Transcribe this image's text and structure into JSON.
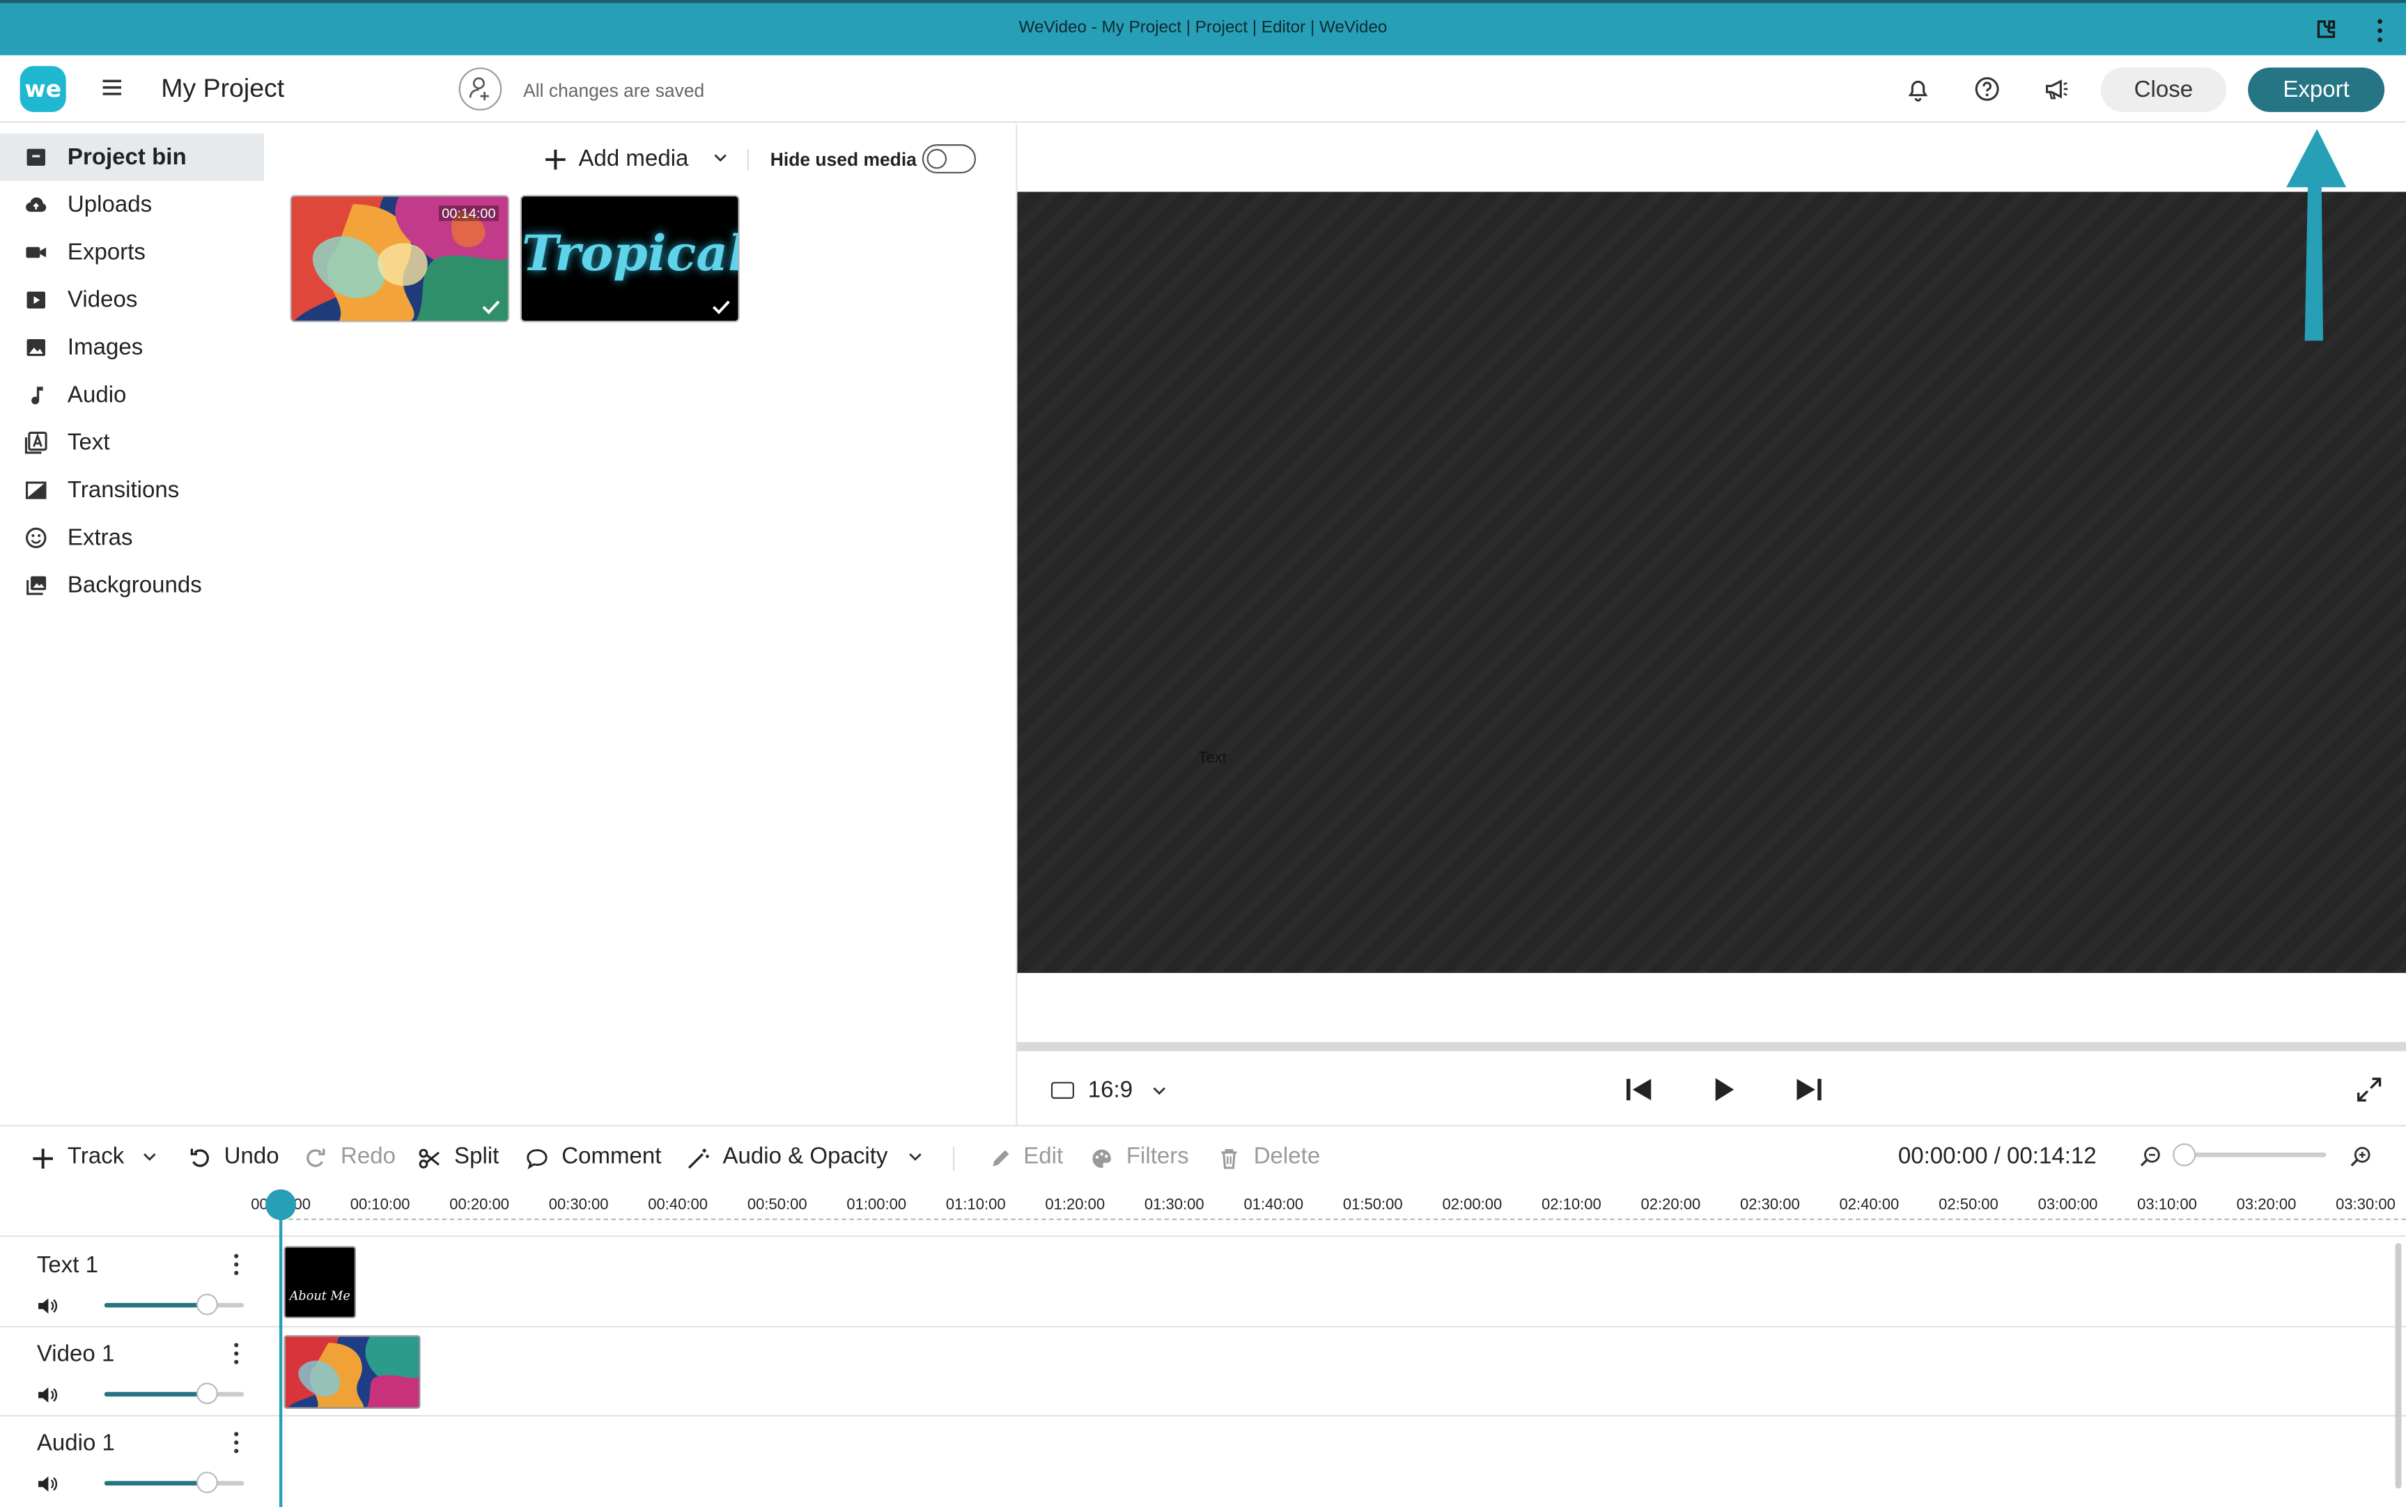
{
  "window": {
    "title": "WeVideo - My Project | Project | Editor | WeVideo"
  },
  "header": {
    "logo_text": "we",
    "project_title": "My Project",
    "save_status": "All changes are saved",
    "close_label": "Close",
    "export_label": "Export"
  },
  "sidebar": {
    "items": [
      {
        "label": "Project bin",
        "icon": "archive-icon",
        "active": true
      },
      {
        "label": "Uploads",
        "icon": "cloud-upload-icon"
      },
      {
        "label": "Exports",
        "icon": "video-camera-icon"
      },
      {
        "label": "Videos",
        "icon": "play-square-icon"
      },
      {
        "label": "Images",
        "icon": "image-icon"
      },
      {
        "label": "Audio",
        "icon": "music-note-icon"
      },
      {
        "label": "Text",
        "icon": "text-icon"
      },
      {
        "label": "Transitions",
        "icon": "transition-icon"
      },
      {
        "label": "Extras",
        "icon": "smiley-icon"
      },
      {
        "label": "Backgrounds",
        "icon": "backgrounds-icon"
      }
    ]
  },
  "media": {
    "add_media_label": "Add media",
    "hide_used_label": "Hide used media",
    "hide_used_on": false,
    "items": [
      {
        "type": "video",
        "duration": "00:14:00",
        "used": true
      },
      {
        "type": "text",
        "title_text": "Tropical",
        "used": true
      }
    ]
  },
  "preview": {
    "overlay_text": "Text",
    "aspect_ratio": "16:9"
  },
  "toolbar": {
    "track_label": "Track",
    "undo_label": "Undo",
    "redo_label": "Redo",
    "split_label": "Split",
    "comment_label": "Comment",
    "audio_opacity_label": "Audio & Opacity",
    "edit_label": "Edit",
    "filters_label": "Filters",
    "delete_label": "Delete",
    "timecode": "00:00:00 / 00:14:12"
  },
  "ruler": {
    "ticks": [
      "00:00:00",
      "00:10:00",
      "00:20:00",
      "00:30:00",
      "00:40:00",
      "00:50:00",
      "01:00:00",
      "01:10:00",
      "01:20:00",
      "01:30:00",
      "01:40:00",
      "01:50:00",
      "02:00:00",
      "02:10:00",
      "02:20:00",
      "02:30:00",
      "02:40:00",
      "02:50:00",
      "03:00:00",
      "03:10:00",
      "03:20:00",
      "03:30:00"
    ]
  },
  "tracks": [
    {
      "name": "Text 1",
      "volume": 0.73,
      "clip_text": "About Me"
    },
    {
      "name": "Video 1",
      "volume": 0.73
    },
    {
      "name": "Audio 1",
      "volume": 0.73
    }
  ],
  "colors": {
    "titlebar": "#27a0b7",
    "accent": "#267585",
    "playhead": "#27a0b7",
    "player_bg": "#262626"
  }
}
